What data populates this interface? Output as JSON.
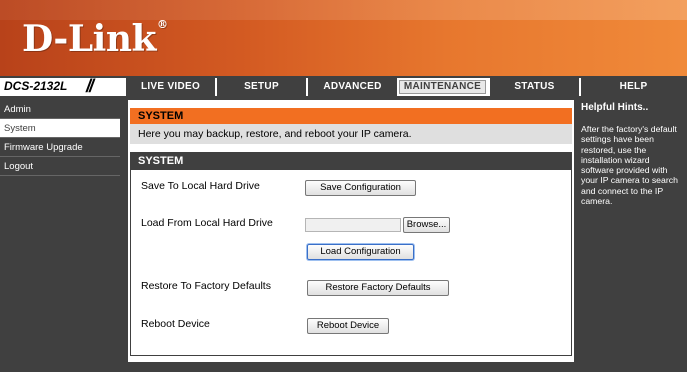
{
  "brand": {
    "logo_text": "D-Link",
    "logo_mark": "®"
  },
  "model": "DCS-2132L",
  "nav": {
    "tabs": [
      {
        "label": "LIVE VIDEO"
      },
      {
        "label": "SETUP"
      },
      {
        "label": "ADVANCED"
      },
      {
        "label": "MAINTENANCE",
        "active": true
      },
      {
        "label": "STATUS"
      },
      {
        "label": "HELP"
      }
    ]
  },
  "sidebar": {
    "items": [
      {
        "label": "Admin"
      },
      {
        "label": "System",
        "active": true
      },
      {
        "label": "Firmware Upgrade"
      },
      {
        "label": "Logout"
      }
    ]
  },
  "main": {
    "header": "SYSTEM",
    "description": "Here you may backup, restore, and reboot your IP camera.",
    "section_header": "SYSTEM",
    "save_label": "Save To Local Hard Drive",
    "save_button": "Save Configuration",
    "load_label": "Load From Local Hard Drive",
    "browse_button": "Browse...",
    "file_value": "",
    "load_button": "Load Configuration",
    "restore_label": "Restore To Factory Defaults",
    "restore_button": "Restore Factory Defaults",
    "reboot_label": "Reboot Device",
    "reboot_button": "Reboot Device"
  },
  "hints": {
    "title": "Helpful Hints..",
    "text": "After the factory's default settings have been restored, use the installation wizard software provided with your IP camera to search and connect to the IP camera."
  },
  "colors": {
    "accent": "#f26f21",
    "dark": "#404040",
    "light_row": "#dfdfdf"
  }
}
